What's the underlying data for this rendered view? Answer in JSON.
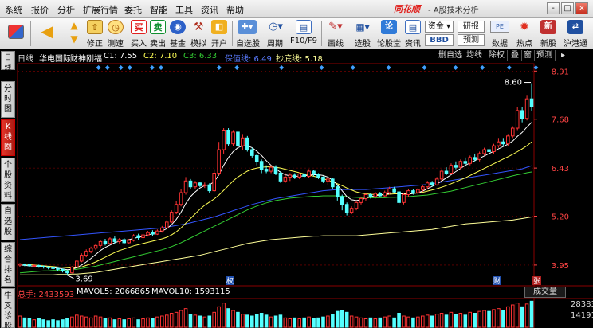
{
  "menu": [
    "系统",
    "报价",
    "分析",
    "扩展行情",
    "委托",
    "智能",
    "工具",
    "资讯",
    "帮助"
  ],
  "brand": {
    "logo": "同花顺",
    "app": "- A股技术分析"
  },
  "window_controls": [
    "-",
    "□",
    "×"
  ],
  "toolbar": {
    "buttons": [
      {
        "label": "修正",
        "icon": "up-arrow-icon"
      },
      {
        "label": "测速",
        "icon": "clock-icon"
      },
      {
        "label": "买入",
        "icon": "buy-icon",
        "glyph": "买"
      },
      {
        "label": "卖出",
        "icon": "sell-icon",
        "glyph": "卖"
      },
      {
        "label": "基金",
        "icon": "fund-icon"
      },
      {
        "label": "模拟",
        "icon": "hammer-icon"
      },
      {
        "label": "开户",
        "icon": "open-account-icon"
      },
      {
        "label": "自选股",
        "icon": "watchlist-icon"
      },
      {
        "label": "周期",
        "icon": "period-clock-icon"
      },
      {
        "label": "F10/F9",
        "icon": "f10-icon"
      },
      {
        "label": "画线",
        "icon": "pencil-icon"
      },
      {
        "label": "选股",
        "icon": "stock-picker-icon"
      },
      {
        "label": "论股堂",
        "icon": "forum-icon"
      },
      {
        "label": "资讯",
        "icon": "news-icon"
      },
      {
        "label": "数据",
        "icon": "data-icon"
      },
      {
        "label": "热点",
        "icon": "hot-spot-icon"
      },
      {
        "label": "新股",
        "icon": "new-stock-icon"
      },
      {
        "label": "沪港通",
        "icon": "hk-connect-icon"
      }
    ],
    "boxes": [
      {
        "label": "资金",
        "icon": "fund-flow-icon"
      },
      {
        "label": "研报"
      },
      {
        "label": "BBD"
      },
      {
        "label": "预测"
      },
      {
        "label": "PE"
      }
    ]
  },
  "side_tabs": [
    {
      "label": "分时图",
      "active": false
    },
    {
      "label": "K线图",
      "active": true
    },
    {
      "label": "个股资料",
      "active": false
    },
    {
      "label": "自选股",
      "active": false
    },
    {
      "label": "综合排名",
      "active": false
    },
    {
      "label": "牛叉诊股",
      "active": false
    }
  ],
  "kline": {
    "period": "日线",
    "stock_name": "华电国际",
    "indicator": "财神刚福",
    "c1_label": "C1: 7.55",
    "c2_label": "C2: 7.10",
    "c3_label": "C3: 6.33",
    "hold_label": "保值线: 6.49",
    "bottom_label": "抄底线: 5.18",
    "sub_tabs": [
      "删自选",
      "均线",
      "除权",
      "叠",
      "窗",
      "预测"
    ],
    "price_axis": [
      "8.91",
      "7.68",
      "6.43",
      "5.20",
      "3.95"
    ],
    "high_marker": "8.60",
    "low_marker": "3.69",
    "event_markers": [
      "权",
      "财",
      "张"
    ],
    "colors": {
      "up": "#ff3333",
      "down": "#54ffff",
      "c1": "#ffffff",
      "c2": "#ffff55",
      "c3": "#33cc33",
      "hold": "#3355ff",
      "bottom": "#ffff99",
      "grid": "#8b0000"
    }
  },
  "volume": {
    "total_label": "总手: 2433593",
    "mavol5_label": "MAVOL5: 2066865",
    "mavol10_label": "MAVOL10: 1593115",
    "axis": [
      "28383",
      "14191"
    ],
    "unit": "成交量"
  },
  "chart_data": {
    "type": "candlestick",
    "title": "华电国际 日线",
    "y_axis_ticks": [
      8.91,
      7.68,
      6.43,
      5.2,
      3.95
    ],
    "ylim": [
      3.5,
      9.1
    ],
    "candles": [
      [
        3.95,
        3.98,
        3.9,
        4.0
      ],
      [
        3.97,
        3.96,
        3.92,
        3.99
      ],
      [
        3.96,
        3.93,
        3.9,
        3.98
      ],
      [
        3.93,
        3.94,
        3.9,
        3.97
      ],
      [
        3.94,
        3.92,
        3.88,
        3.96
      ],
      [
        3.92,
        3.9,
        3.86,
        3.94
      ],
      [
        3.9,
        3.88,
        3.84,
        3.92
      ],
      [
        3.88,
        3.86,
        3.82,
        3.9
      ],
      [
        3.86,
        3.84,
        3.8,
        3.88
      ],
      [
        3.84,
        3.8,
        3.76,
        3.86
      ],
      [
        3.8,
        3.75,
        3.69,
        3.82
      ],
      [
        3.75,
        3.9,
        3.74,
        3.92
      ],
      [
        3.9,
        4.05,
        3.88,
        4.08
      ],
      [
        4.05,
        4.2,
        4.02,
        4.25
      ],
      [
        4.2,
        4.3,
        4.15,
        4.35
      ],
      [
        4.3,
        4.38,
        4.25,
        4.42
      ],
      [
        4.38,
        4.45,
        4.33,
        4.5
      ],
      [
        4.45,
        4.55,
        4.4,
        4.6
      ],
      [
        4.55,
        4.5,
        4.45,
        4.62
      ],
      [
        4.5,
        4.62,
        4.48,
        4.66
      ],
      [
        4.62,
        4.55,
        4.5,
        4.68
      ],
      [
        4.55,
        4.6,
        4.5,
        4.64
      ],
      [
        4.6,
        4.52,
        4.48,
        4.64
      ],
      [
        4.52,
        4.58,
        4.48,
        4.62
      ],
      [
        4.58,
        4.7,
        4.55,
        4.74
      ],
      [
        4.7,
        4.65,
        4.6,
        4.75
      ],
      [
        4.65,
        4.72,
        4.6,
        4.76
      ],
      [
        4.72,
        4.78,
        4.68,
        4.82
      ],
      [
        4.78,
        4.74,
        4.7,
        4.84
      ],
      [
        4.74,
        4.82,
        4.72,
        4.86
      ],
      [
        4.82,
        4.9,
        4.78,
        4.95
      ],
      [
        4.9,
        5.05,
        4.88,
        5.1
      ],
      [
        5.05,
        5.3,
        5.02,
        5.35
      ],
      [
        5.3,
        5.5,
        5.25,
        5.58
      ],
      [
        5.5,
        5.8,
        5.45,
        5.9
      ],
      [
        5.8,
        6.1,
        5.75,
        6.2
      ],
      [
        6.1,
        5.95,
        5.9,
        6.15
      ],
      [
        5.95,
        6.05,
        5.9,
        6.1
      ],
      [
        6.05,
        5.98,
        5.94,
        6.08
      ],
      [
        5.98,
        6.0,
        5.92,
        6.06
      ],
      [
        6.0,
        5.85,
        5.8,
        6.04
      ],
      [
        5.85,
        6.3,
        5.82,
        6.4
      ],
      [
        6.3,
        6.9,
        6.25,
        7.1
      ],
      [
        6.9,
        7.4,
        6.8,
        7.45
      ],
      [
        7.4,
        7.05,
        7.0,
        7.45
      ],
      [
        7.05,
        7.35,
        7.0,
        7.4
      ],
      [
        7.35,
        7.0,
        6.95,
        7.38
      ],
      [
        7.0,
        7.2,
        6.9,
        7.3
      ],
      [
        7.2,
        6.9,
        6.85,
        7.25
      ],
      [
        6.9,
        6.75,
        6.7,
        6.95
      ],
      [
        6.75,
        6.6,
        6.5,
        6.8
      ],
      [
        6.6,
        6.4,
        6.3,
        6.65
      ],
      [
        6.4,
        6.35,
        6.3,
        6.5
      ],
      [
        6.35,
        6.45,
        6.3,
        6.5
      ],
      [
        6.45,
        6.3,
        6.25,
        6.5
      ],
      [
        6.3,
        6.1,
        6.05,
        6.35
      ],
      [
        6.1,
        6.2,
        6.05,
        6.3
      ],
      [
        6.2,
        6.25,
        6.1,
        6.3
      ],
      [
        6.25,
        6.2,
        6.15,
        6.3
      ],
      [
        6.2,
        6.28,
        6.15,
        6.32
      ],
      [
        6.28,
        6.22,
        6.18,
        6.3
      ],
      [
        6.22,
        6.35,
        6.18,
        6.4
      ],
      [
        6.35,
        6.28,
        6.22,
        6.38
      ],
      [
        6.28,
        6.2,
        6.15,
        6.3
      ],
      [
        6.2,
        6.1,
        6.05,
        6.22
      ],
      [
        6.1,
        6.15,
        6.0,
        6.2
      ],
      [
        6.15,
        5.95,
        5.9,
        6.18
      ],
      [
        5.95,
        5.7,
        5.6,
        6.0
      ],
      [
        5.7,
        5.5,
        5.35,
        5.75
      ],
      [
        5.5,
        5.3,
        5.22,
        5.55
      ],
      [
        5.3,
        5.4,
        5.25,
        5.45
      ],
      [
        5.4,
        5.55,
        5.35,
        5.6
      ],
      [
        5.55,
        5.65,
        5.5,
        5.7
      ],
      [
        5.65,
        5.75,
        5.6,
        5.8
      ],
      [
        5.75,
        5.7,
        5.65,
        5.8
      ],
      [
        5.7,
        5.78,
        5.65,
        5.82
      ],
      [
        5.78,
        5.72,
        5.68,
        5.82
      ],
      [
        5.72,
        5.8,
        5.68,
        5.85
      ],
      [
        5.8,
        5.9,
        5.75,
        5.95
      ],
      [
        5.9,
        5.82,
        5.78,
        5.95
      ],
      [
        5.82,
        5.55,
        5.5,
        5.85
      ],
      [
        5.55,
        5.75,
        5.5,
        5.8
      ],
      [
        5.75,
        5.85,
        5.7,
        5.9
      ],
      [
        5.85,
        5.8,
        5.75,
        5.9
      ],
      [
        5.8,
        5.88,
        5.75,
        5.92
      ],
      [
        5.88,
        5.95,
        5.82,
        6.0
      ],
      [
        5.95,
        6.05,
        5.9,
        6.1
      ],
      [
        6.05,
        6.0,
        5.95,
        6.1
      ],
      [
        6.0,
        6.15,
        5.98,
        6.2
      ],
      [
        6.15,
        6.35,
        6.1,
        6.4
      ],
      [
        6.35,
        6.3,
        6.25,
        6.45
      ],
      [
        6.3,
        6.5,
        6.28,
        6.55
      ],
      [
        6.5,
        6.45,
        6.4,
        6.6
      ],
      [
        6.45,
        6.6,
        6.4,
        6.65
      ],
      [
        6.6,
        6.55,
        6.5,
        6.7
      ],
      [
        6.55,
        6.7,
        6.5,
        6.75
      ],
      [
        6.7,
        6.65,
        6.6,
        6.8
      ],
      [
        6.65,
        6.8,
        6.6,
        6.85
      ],
      [
        6.8,
        6.9,
        6.75,
        6.95
      ],
      [
        6.9,
        6.85,
        6.8,
        7.0
      ],
      [
        6.85,
        7.0,
        6.8,
        7.05
      ],
      [
        7.0,
        7.1,
        6.95,
        7.2
      ],
      [
        7.1,
        7.05,
        7.0,
        7.2
      ],
      [
        7.05,
        7.25,
        7.0,
        7.3
      ],
      [
        7.25,
        7.45,
        7.2,
        7.5
      ],
      [
        7.45,
        7.9,
        7.4,
        8.0
      ],
      [
        7.9,
        7.7,
        7.6,
        8.0
      ],
      [
        7.7,
        8.2,
        7.65,
        8.3
      ],
      [
        8.2,
        8.0,
        7.9,
        8.6
      ]
    ],
    "lines": {
      "C1": [
        3.95,
        3.94,
        3.93,
        3.92,
        3.92,
        3.91,
        3.9,
        3.88,
        3.87,
        3.85,
        3.83,
        3.84,
        3.88,
        3.95,
        4.03,
        4.12,
        4.22,
        4.32,
        4.4,
        4.46,
        4.52,
        4.56,
        4.58,
        4.6,
        4.63,
        4.66,
        4.68,
        4.72,
        4.75,
        4.78,
        4.82,
        4.88,
        4.98,
        5.12,
        5.3,
        5.52,
        5.7,
        5.82,
        5.92,
        5.98,
        6.0,
        6.08,
        6.26,
        6.5,
        6.7,
        6.85,
        6.95,
        7.0,
        7.0,
        6.95,
        6.86,
        6.75,
        6.62,
        6.5,
        6.42,
        6.32,
        6.26,
        6.23,
        6.22,
        6.22,
        6.23,
        6.25,
        6.26,
        6.26,
        6.24,
        6.2,
        6.12,
        6.0,
        5.85,
        5.7,
        5.62,
        5.6,
        5.62,
        5.66,
        5.7,
        5.72,
        5.74,
        5.75,
        5.78,
        5.8,
        5.78,
        5.76,
        5.76,
        5.78,
        5.8,
        5.84,
        5.9,
        5.96,
        6.02,
        6.1,
        6.18,
        6.26,
        6.34,
        6.42,
        6.5,
        6.56,
        6.62,
        6.68,
        6.74,
        6.8,
        6.86,
        6.92,
        6.98,
        7.04,
        7.12,
        7.24,
        7.34,
        7.48,
        7.6
      ],
      "C2": [
        3.98,
        3.97,
        3.96,
        3.95,
        3.94,
        3.93,
        3.92,
        3.91,
        3.9,
        3.89,
        3.88,
        3.87,
        3.88,
        3.9,
        3.94,
        3.98,
        4.03,
        4.09,
        4.15,
        4.21,
        4.27,
        4.32,
        4.36,
        4.4,
        4.44,
        4.47,
        4.5,
        4.53,
        4.56,
        4.59,
        4.62,
        4.66,
        4.72,
        4.8,
        4.9,
        5.02,
        5.14,
        5.26,
        5.38,
        5.48,
        5.56,
        5.64,
        5.74,
        5.86,
        5.98,
        6.1,
        6.2,
        6.28,
        6.35,
        6.4,
        6.43,
        6.45,
        6.46,
        6.46,
        6.45,
        6.43,
        6.4,
        6.37,
        6.34,
        6.31,
        6.28,
        6.25,
        6.22,
        6.19,
        6.16,
        6.12,
        6.08,
        6.03,
        5.98,
        5.92,
        5.87,
        5.82,
        5.79,
        5.77,
        5.76,
        5.75,
        5.75,
        5.75,
        5.76,
        5.77,
        5.77,
        5.77,
        5.77,
        5.78,
        5.79,
        5.81,
        5.84,
        5.87,
        5.9,
        5.94,
        5.98,
        6.03,
        6.08,
        6.13,
        6.18,
        6.24,
        6.3,
        6.36,
        6.42,
        6.48,
        6.54,
        6.6,
        6.66,
        6.72,
        6.78,
        6.85,
        6.92,
        7.0,
        7.1
      ],
      "C3": [
        3.75,
        3.76,
        3.77,
        3.78,
        3.79,
        3.8,
        3.8,
        3.81,
        3.81,
        3.82,
        3.82,
        3.83,
        3.84,
        3.86,
        3.88,
        3.9,
        3.92,
        3.95,
        3.98,
        4.01,
        4.04,
        4.07,
        4.1,
        4.13,
        4.16,
        4.19,
        4.22,
        4.25,
        4.28,
        4.31,
        4.34,
        4.38,
        4.42,
        4.47,
        4.52,
        4.58,
        4.64,
        4.7,
        4.76,
        4.82,
        4.88,
        4.94,
        5.0,
        5.06,
        5.12,
        5.18,
        5.24,
        5.3,
        5.36,
        5.41,
        5.46,
        5.5,
        5.54,
        5.57,
        5.6,
        5.62,
        5.64,
        5.66,
        5.67,
        5.68,
        5.69,
        5.7,
        5.71,
        5.71,
        5.72,
        5.72,
        5.72,
        5.72,
        5.71,
        5.7,
        5.69,
        5.68,
        5.67,
        5.67,
        5.67,
        5.67,
        5.67,
        5.67,
        5.68,
        5.68,
        5.69,
        5.69,
        5.7,
        5.71,
        5.72,
        5.73,
        5.74,
        5.76,
        5.78,
        5.8,
        5.82,
        5.84,
        5.87,
        5.9,
        5.93,
        5.96,
        5.99,
        6.02,
        6.05,
        6.08,
        6.11,
        6.14,
        6.17,
        6.2,
        6.23,
        6.26,
        6.28,
        6.31,
        6.33
      ],
      "hold": [
        4.6,
        4.61,
        4.62,
        4.63,
        4.64,
        4.65,
        4.66,
        4.67,
        4.68,
        4.69,
        4.7,
        4.71,
        4.72,
        4.73,
        4.74,
        4.75,
        4.76,
        4.77,
        4.78,
        4.79,
        4.8,
        4.81,
        4.82,
        4.83,
        4.84,
        4.85,
        4.86,
        4.87,
        4.88,
        4.89,
        4.9,
        4.92,
        4.94,
        4.96,
        4.98,
        5.0,
        5.03,
        5.06,
        5.09,
        5.12,
        5.15,
        5.18,
        5.22,
        5.26,
        5.3,
        5.34,
        5.38,
        5.42,
        5.46,
        5.5,
        5.53,
        5.56,
        5.59,
        5.62,
        5.65,
        5.67,
        5.69,
        5.71,
        5.73,
        5.75,
        5.77,
        5.79,
        5.81,
        5.83,
        5.85,
        5.86,
        5.87,
        5.88,
        5.88,
        5.88,
        5.88,
        5.88,
        5.88,
        5.88,
        5.89,
        5.9,
        5.91,
        5.92,
        5.93,
        5.94,
        5.95,
        5.96,
        5.97,
        5.98,
        5.99,
        6.0,
        6.01,
        6.03,
        6.05,
        6.07,
        6.09,
        6.11,
        6.13,
        6.15,
        6.17,
        6.19,
        6.21,
        6.23,
        6.25,
        6.27,
        6.29,
        6.31,
        6.33,
        6.35,
        6.37,
        6.39,
        6.41,
        6.45,
        6.49
      ],
      "bottom": [
        3.7,
        3.7,
        3.7,
        3.7,
        3.7,
        3.7,
        3.7,
        3.7,
        3.71,
        3.71,
        3.71,
        3.72,
        3.72,
        3.73,
        3.74,
        3.75,
        3.76,
        3.78,
        3.8,
        3.82,
        3.84,
        3.86,
        3.88,
        3.9,
        3.92,
        3.94,
        3.96,
        3.98,
        4.0,
        4.02,
        4.04,
        4.06,
        4.08,
        4.1,
        4.12,
        4.14,
        4.16,
        4.18,
        4.2,
        4.23,
        4.26,
        4.29,
        4.32,
        4.35,
        4.38,
        4.41,
        4.44,
        4.47,
        4.5,
        4.52,
        4.54,
        4.56,
        4.58,
        4.6,
        4.61,
        4.62,
        4.63,
        4.64,
        4.65,
        4.66,
        4.67,
        4.68,
        4.69,
        4.69,
        4.7,
        4.7,
        4.7,
        4.7,
        4.7,
        4.7,
        4.7,
        4.7,
        4.71,
        4.72,
        4.73,
        4.74,
        4.75,
        4.76,
        4.77,
        4.78,
        4.79,
        4.8,
        4.81,
        4.82,
        4.83,
        4.84,
        4.85,
        4.86,
        4.88,
        4.9,
        4.92,
        4.94,
        4.96,
        4.98,
        5.0,
        5.01,
        5.02,
        5.03,
        5.04,
        5.05,
        5.06,
        5.07,
        5.08,
        5.09,
        5.1,
        5.12,
        5.14,
        5.16,
        5.18
      ]
    },
    "volume": [
      12,
      10,
      9,
      8,
      9,
      8,
      7,
      8,
      7,
      8,
      9,
      11,
      13,
      12,
      11,
      10,
      12,
      11,
      9,
      10,
      8,
      9,
      8,
      9,
      10,
      8,
      9,
      10,
      9,
      11,
      12,
      13,
      15,
      16,
      18,
      20,
      14,
      13,
      12,
      11,
      12,
      16,
      22,
      26,
      20,
      18,
      16,
      14,
      13,
      12,
      14,
      15,
      13,
      11,
      12,
      13,
      10,
      9,
      10,
      9,
      10,
      11,
      9,
      10,
      11,
      12,
      14,
      17,
      18,
      16,
      12,
      11,
      10,
      9,
      10,
      9,
      10,
      11,
      12,
      10,
      15,
      12,
      11,
      10,
      11,
      12,
      13,
      12,
      14,
      15,
      13,
      16,
      14,
      15,
      13,
      16,
      15,
      17,
      18,
      17,
      19,
      20,
      18,
      22,
      24,
      26,
      22,
      25,
      28
    ]
  }
}
